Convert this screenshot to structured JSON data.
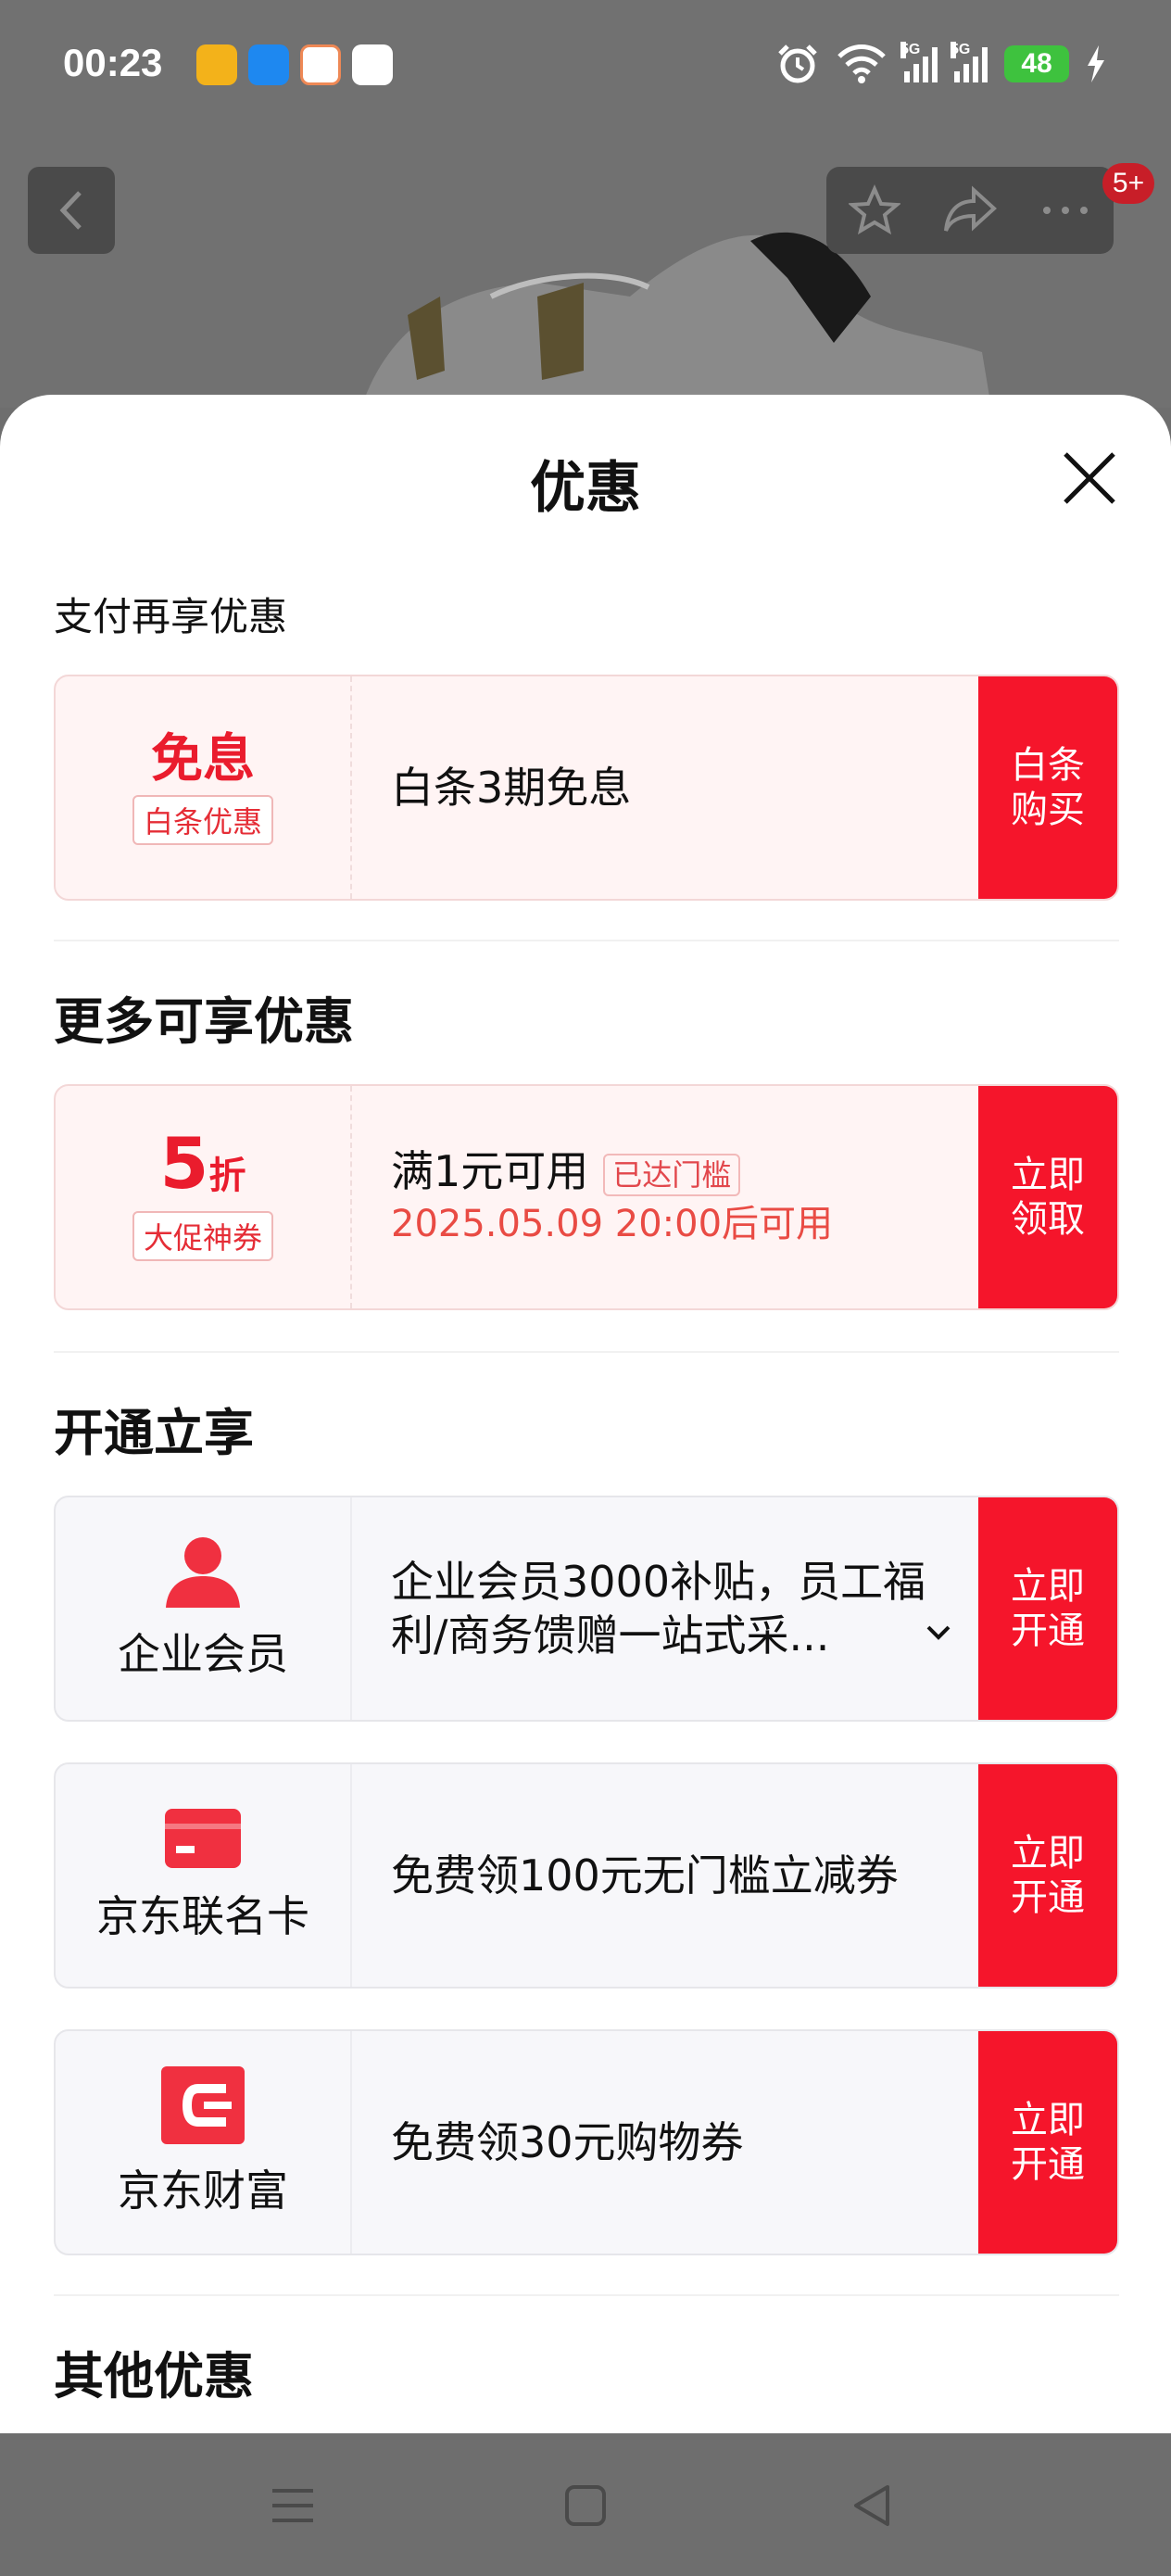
{
  "status_bar": {
    "time": "00:23",
    "battery": "48",
    "network_label_1": "5G",
    "network_label_2": "5G"
  },
  "header": {
    "cart_badge": "5+"
  },
  "sheet": {
    "title": "优惠",
    "sections": {
      "payment": "支付再享优惠",
      "more": "更多可享优惠",
      "membership": "开通立享",
      "other": "其他优惠"
    },
    "baitiao": {
      "big": "免息",
      "tag": "白条优惠",
      "text": "白条3期免息",
      "button": "白条购买"
    },
    "coupon": {
      "big_num": "5",
      "big_unit": "折",
      "tag": "大促神券",
      "text": "满1元可用",
      "threshold": "已达门槛",
      "time": "2025.05.09 20:00后可用",
      "button": "立即领取"
    },
    "enterprise": {
      "label": "企业会员",
      "text": "企业会员3000补贴，员工福利/商务馈赠一站式采...",
      "button": "立即开通"
    },
    "jd_card": {
      "label": "京东联名卡",
      "text": "免费领100元无门槛立减券",
      "button": "立即开通"
    },
    "jd_finance": {
      "label": "京东财富",
      "text": "免费领30元购物券",
      "button": "立即开通"
    }
  },
  "colors": {
    "accent_red": "#f5152b",
    "tag_red": "#e52d36"
  }
}
